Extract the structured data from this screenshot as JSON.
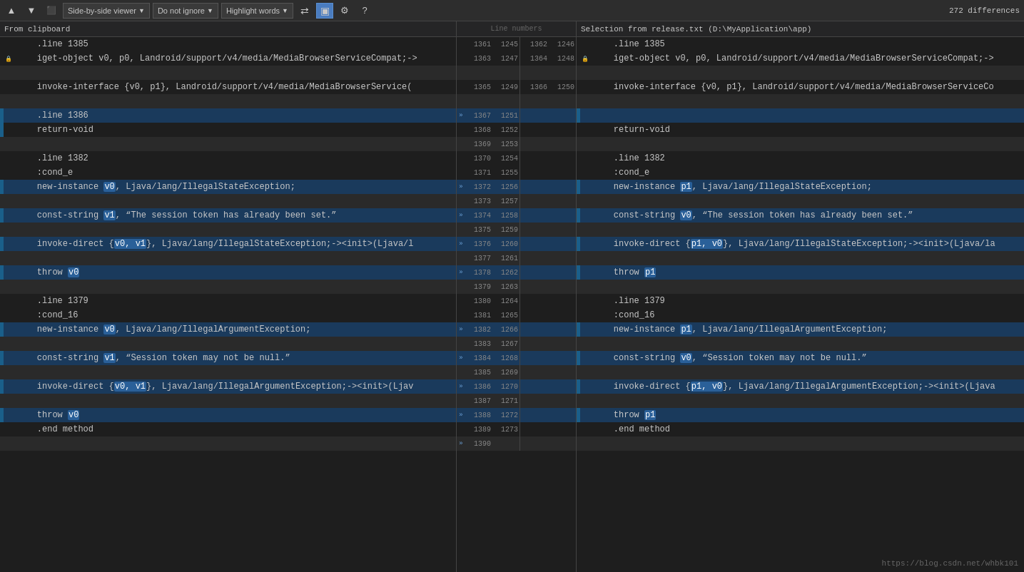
{
  "toolbar": {
    "nav_up": "▲",
    "nav_down": "▼",
    "nav_first": "⏮",
    "viewer_label": "Side-by-side viewer",
    "ignore_label": "Do not ignore",
    "highlight_label": "Highlight words",
    "icon_swap": "⇄",
    "icon_sync": "⊟",
    "icon_settings": "⚙",
    "icon_help": "?",
    "diff_count": "272 differences"
  },
  "left_header": "From clipboard",
  "right_header": "Selection from release.txt (D:\\MyApplication\\app)",
  "watermark": "https://blog.csdn.net/whbk101",
  "lines": [
    {
      "left_content": "    .line 1385",
      "right_content": "    .line 1385",
      "type": "normal",
      "ln_left": "1361",
      "ln_left2": "1245",
      "ln_right": "1362",
      "ln_right2": "1246"
    },
    {
      "left_content": "    iget-object v0, p0, Landroid/support/v4/media/MediaBrowserServiceCompat;->",
      "right_content": "    iget-object v0, p0, Landroid/support/v4/media/MediaBrowserServiceCompat;->",
      "type": "normal",
      "ln_left": "1363",
      "ln_left2": "1247",
      "ln_right": "1364",
      "ln_right2": "1248",
      "left_lock": true,
      "right_lock": true
    },
    {
      "left_content": "",
      "right_content": "",
      "type": "empty",
      "ln_left": "",
      "ln_left2": "",
      "ln_right": "",
      "ln_right2": ""
    },
    {
      "left_content": "    invoke-interface {v0, p1}, Landroid/support/v4/media/MediaBrowserService(",
      "right_content": "    invoke-interface {v0, p1}, Landroid/support/v4/media/MediaBrowserServiceCo",
      "type": "normal",
      "ln_left": "1365",
      "ln_left2": "1249",
      "ln_right": "1366",
      "ln_right2": "1250"
    },
    {
      "left_content": "",
      "right_content": "",
      "type": "empty",
      "ln_left": "",
      "ln_left2": "",
      "ln_right": "",
      "ln_right2": ""
    },
    {
      "left_content": "    .line 1386",
      "right_content": "",
      "type": "changed",
      "ln_left": "1367",
      "ln_left2": "1251",
      "ln_right": "",
      "ln_right2": "",
      "arrow_left": "»"
    },
    {
      "left_content": "    return-void",
      "right_content": "    return-void",
      "type": "normal",
      "ln_left": "1368",
      "ln_left2": "1252",
      "ln_right": "",
      "ln_right2": "",
      "arrow_right": "«"
    },
    {
      "left_content": "",
      "right_content": "",
      "type": "empty",
      "ln_left": "1369",
      "ln_left2": "1253",
      "ln_right": "",
      "ln_right2": ""
    },
    {
      "left_content": "    .line 1382",
      "right_content": "    .line 1382",
      "type": "normal",
      "ln_left": "1370",
      "ln_left2": "1254",
      "ln_right": "",
      "ln_right2": ""
    },
    {
      "left_content": "    :cond_e",
      "right_content": "    :cond_e",
      "type": "normal",
      "ln_left": "1371",
      "ln_left2": "1255",
      "ln_right": "",
      "ln_right2": ""
    },
    {
      "left_content": "    new-instance v0, Ljava/lang/IllegalStateException;",
      "right_content": "    new-instance p1, Ljava/lang/IllegalStateException;",
      "type": "changed",
      "ln_left": "1372",
      "ln_left2": "1256",
      "ln_right": "",
      "ln_right2": "",
      "arrow_left": "»",
      "arrow_right": "«",
      "hl_left": "v0",
      "hl_right": "p1"
    },
    {
      "left_content": "",
      "right_content": "",
      "type": "empty",
      "ln_left": "1373",
      "ln_left2": "1257",
      "ln_right": "",
      "ln_right2": ""
    },
    {
      "left_content": "    const-string v1, “The session token has already been set.”",
      "right_content": "    const-string v0, “The session token has already been set.”",
      "type": "changed",
      "ln_left": "1374",
      "ln_left2": "1258",
      "ln_right": "",
      "ln_right2": "",
      "arrow_left": "»",
      "arrow_right": "«",
      "hl_left": "v1",
      "hl_right": "v0"
    },
    {
      "left_content": "",
      "right_content": "",
      "type": "empty",
      "ln_left": "1375",
      "ln_left2": "1259",
      "ln_right": "",
      "ln_right2": ""
    },
    {
      "left_content": "    invoke-direct {v0, v1}, Ljava/lang/IllegalStateException;-><init>(Ljava/l",
      "right_content": "    invoke-direct {p1, v0}, Ljava/lang/IllegalStateException;-><init>(Ljava/la",
      "type": "changed",
      "ln_left": "1376",
      "ln_left2": "1260",
      "ln_right": "",
      "ln_right2": "",
      "arrow_left": "»",
      "arrow_right": "«",
      "hl_left": "v0, v1",
      "hl_right": "p1, v0"
    },
    {
      "left_content": "",
      "right_content": "",
      "type": "empty",
      "ln_left": "1377",
      "ln_left2": "1261",
      "ln_right": "",
      "ln_right2": ""
    },
    {
      "left_content": "    throw v0",
      "right_content": "    throw p1",
      "type": "changed",
      "ln_left": "1378",
      "ln_left2": "1262",
      "ln_right": "",
      "ln_right2": "",
      "arrow_left": "»",
      "arrow_right": "«",
      "hl_left": "v0",
      "hl_right": "p1"
    },
    {
      "left_content": "",
      "right_content": "",
      "type": "empty",
      "ln_left": "1379",
      "ln_left2": "1263",
      "ln_right": "",
      "ln_right2": ""
    },
    {
      "left_content": "    .line 1379",
      "right_content": "    .line 1379",
      "type": "normal",
      "ln_left": "1380",
      "ln_left2": "1264",
      "ln_right": "",
      "ln_right2": ""
    },
    {
      "left_content": "    :cond_16",
      "right_content": "    :cond_16",
      "type": "normal",
      "ln_left": "1381",
      "ln_left2": "1265",
      "ln_right": "",
      "ln_right2": ""
    },
    {
      "left_content": "    new-instance v0, Ljava/lang/IllegalArgumentException;",
      "right_content": "    new-instance p1, Ljava/lang/IllegalArgumentException;",
      "type": "changed",
      "ln_left": "1382",
      "ln_left2": "1266",
      "ln_right": "",
      "ln_right2": "",
      "arrow_left": "»",
      "arrow_right": "«",
      "hl_left": "v0",
      "hl_right": "p1"
    },
    {
      "left_content": "",
      "right_content": "",
      "type": "empty",
      "ln_left": "1383",
      "ln_left2": "1267",
      "ln_right": "",
      "ln_right2": ""
    },
    {
      "left_content": "    const-string v1, “Session token may not be null.”",
      "right_content": "    const-string v0, “Session token may not be null.”",
      "type": "changed",
      "ln_left": "1384",
      "ln_left2": "1268",
      "ln_right": "",
      "ln_right2": "",
      "arrow_left": "»",
      "arrow_right": "«",
      "hl_left": "v1",
      "hl_right": "v0"
    },
    {
      "left_content": "",
      "right_content": "",
      "type": "empty",
      "ln_left": "1385",
      "ln_left2": "1269",
      "ln_right": "",
      "ln_right2": ""
    },
    {
      "left_content": "    invoke-direct {v0, v1}, Ljava/lang/IllegalArgumentException;-><init>(Ljav",
      "right_content": "    invoke-direct {p1, v0}, Ljava/lang/IllegalArgumentException;-><init>(Ljava",
      "type": "changed",
      "ln_left": "1386",
      "ln_left2": "1270",
      "ln_right": "",
      "ln_right2": "",
      "arrow_left": "»",
      "arrow_right": "«",
      "hl_left": "v0, v1",
      "hl_right": "p1, v0"
    },
    {
      "left_content": "",
      "right_content": "",
      "type": "empty",
      "ln_left": "1387",
      "ln_left2": "1271",
      "ln_right": "",
      "ln_right2": ""
    },
    {
      "left_content": "    throw v0",
      "right_content": "    throw p1",
      "type": "changed",
      "ln_left": "1388",
      "ln_left2": "1272",
      "ln_right": "",
      "ln_right2": "",
      "arrow_left": "»",
      "arrow_right": "«",
      "hl_left": "v0",
      "hl_right": "p1"
    },
    {
      "left_content": "    .end method",
      "right_content": "    .end method",
      "type": "normal",
      "ln_left": "1389",
      "ln_left2": "1273",
      "ln_right": "",
      "ln_right2": "",
      "arrow_right": "«"
    },
    {
      "left_content": "",
      "right_content": "",
      "type": "empty",
      "ln_left": "1390",
      "ln_left2": "",
      "ln_right": "",
      "ln_right2": "",
      "arrow_left": "»"
    }
  ]
}
